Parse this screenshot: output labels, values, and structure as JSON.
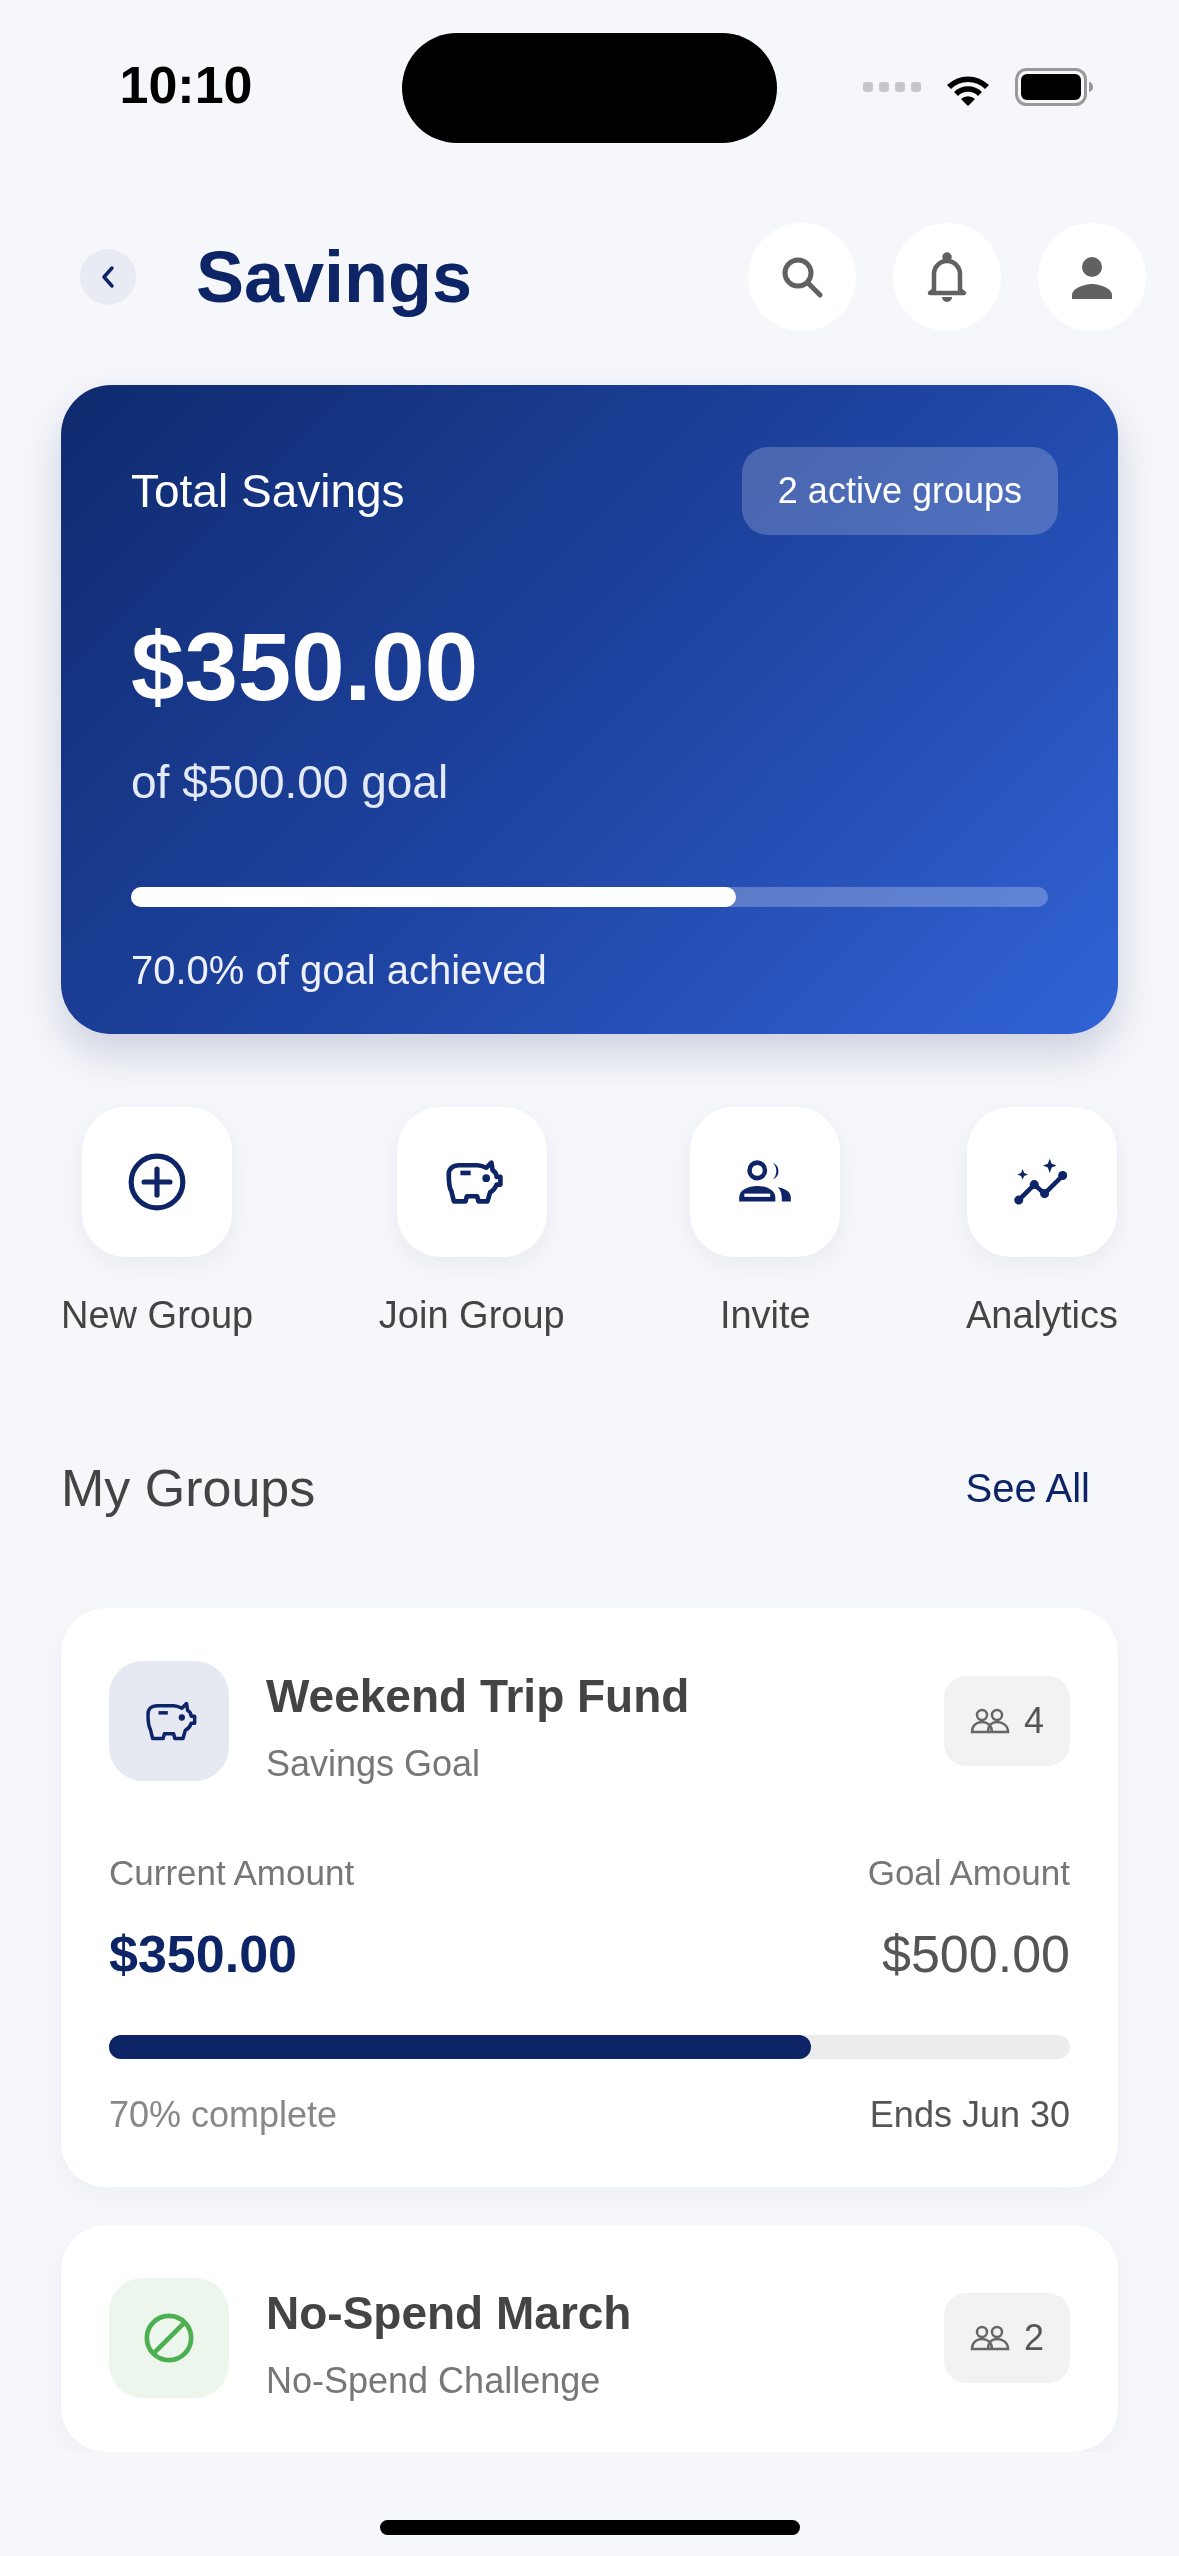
{
  "status_bar": {
    "time": "10:10"
  },
  "header": {
    "title": "Savings"
  },
  "summary": {
    "title": "Total Savings",
    "badge": "2 active groups",
    "amount": "$350.00",
    "goal": "of $500.00 goal",
    "level": 0.66,
    "caption": "70.0% of goal achieved"
  },
  "actions": [
    {
      "label": "New Group",
      "kind": "plus"
    },
    {
      "label": "Join Group",
      "kind": "piggy"
    },
    {
      "label": "Invite",
      "kind": "people"
    },
    {
      "label": "Analytics",
      "kind": "chart"
    }
  ],
  "groups_section": {
    "title": "My Groups",
    "link": "See All"
  },
  "groups": [
    {
      "name": "Weekend Trip Fund",
      "type": "Savings Goal",
      "kind": "savings",
      "members": "4",
      "current_label": "Current Amount",
      "current": "$350.00",
      "goal_label": "Goal Amount",
      "goal": "$500.00",
      "level": 0.73,
      "progress_text": "70% complete",
      "ends": "Ends Jun 30"
    },
    {
      "name": "No-Spend March",
      "type": "No-Spend Challenge",
      "kind": "challenge",
      "members": "2"
    }
  ]
}
